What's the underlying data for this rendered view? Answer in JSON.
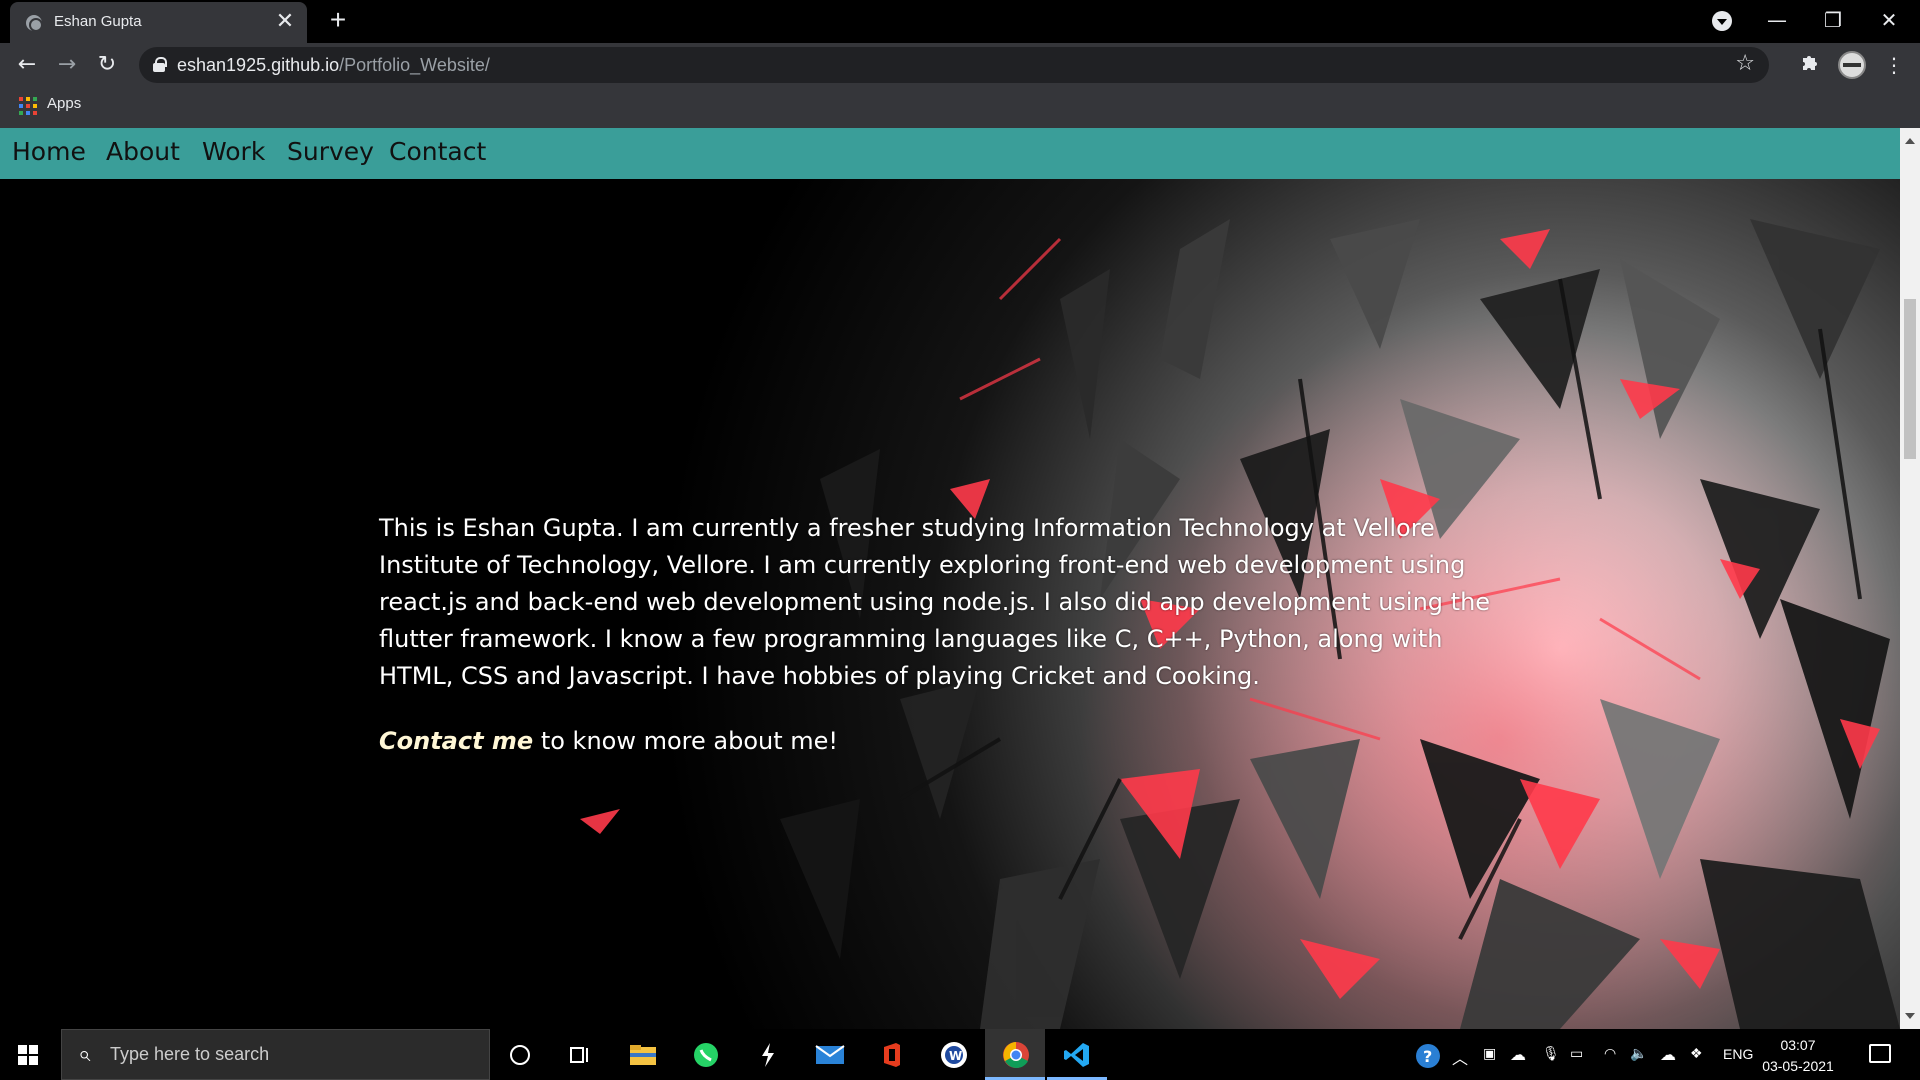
{
  "browser": {
    "tab_title": "Eshan Gupta",
    "tab_close": "✕",
    "new_tab": "+",
    "url_domain": "eshan1925.github.io",
    "url_path": "/Portfolio_Website/",
    "bookmarks_apps": "Apps",
    "window_controls": {
      "minimize": "—",
      "restore": "❐",
      "close": "✕"
    },
    "nav_icons": {
      "back": "←",
      "forward": "→",
      "reload": "↻",
      "star": "☆",
      "extensions": "puzzle-icon",
      "menu": "⋮"
    }
  },
  "site": {
    "nav": [
      "Home",
      "About",
      "Work",
      "Survey",
      "Contact"
    ],
    "intro": "This is Eshan Gupta. I am currently a fresher studying Information Technology at Vellore Institute of Technology, Vellore. I am currently exploring front-end web development using react.js and back-end web development using node.js. I also did app development using the flutter framework. I know a few programming languages like C, C++, Python, along with HTML, CSS and Javascript. I have hobbies of playing Cricket and Cooking.",
    "cta_link": "Contact me",
    "cta_rest": " to know more about me!",
    "colors": {
      "navbar": "#3a9e99",
      "accent_red": "#ff3a4a"
    }
  },
  "taskbar": {
    "search_placeholder": "Type here to search",
    "language": "ENG",
    "time": "03:07",
    "date": "03-05-2021",
    "pinned_apps": [
      "cortana-icon",
      "task-view-icon",
      "file-explorer-icon",
      "whatsapp-icon",
      "lightning-app-icon",
      "mail-icon",
      "office-icon",
      "word-icon",
      "chrome-icon",
      "vscode-icon"
    ]
  }
}
